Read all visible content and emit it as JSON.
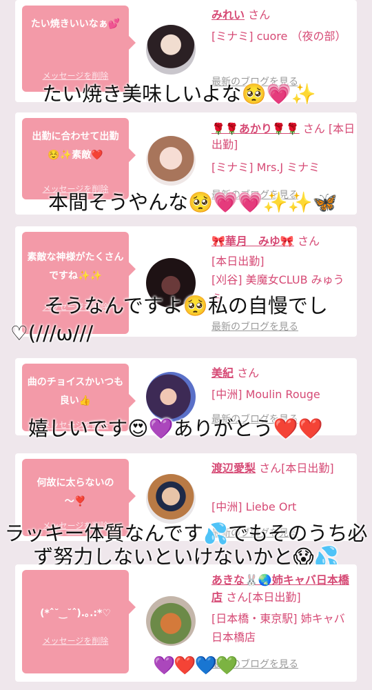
{
  "delete_label": "メッセージを削除",
  "blog_label": "最新のブログを見る",
  "san": "さん",
  "cards": [
    {
      "message": "たい焼きいいなぁ💕",
      "name": "みれい",
      "shop": "[ミナミ] cuore （夜の部）",
      "overlay": "たい焼き美味しいよな🥺💗✨"
    },
    {
      "message": "出勤に合わせて出勤☺️✨素敵❤️",
      "name": "🌹🌹あかり🌹🌹",
      "shop1": "[本日出勤]",
      "shop": "[ミナミ] Mrs.J ミナミ",
      "overlay": "本間そうやんな🥺💗💗✨✨🦋"
    },
    {
      "message": "素敵な神様がたくさんですね✨✨",
      "name": "🎀華月　みゆ🎀",
      "shop1": "[本日出勤]",
      "shop": "[刈谷] 美魔女CLUB みゅうら",
      "overlay_1": "そうなんですよ🥺私の自慢でし",
      "overlay_2": "♡(///ω///"
    },
    {
      "message": "曲のチョイスかいつも良い👍",
      "name": "美紀",
      "shop": "[中洲] Moulin Rouge",
      "overlay": "嬉しいです😍💜ありがとう❤️❤️"
    },
    {
      "message": "何故に太らないの～❣️",
      "name": "渡辺愛梨",
      "shop1": "[本日出勤]",
      "shop": "[中洲] Liebe Ort",
      "overlay_1": "ラッキー体質なんです💦でもそのうち必",
      "overlay_2": "ず努力しないといけないかと😱💦"
    },
    {
      "message": "(*ˆ˘‿˘ˆ).｡.:*♡",
      "name": "あきな🐰🌏姉キャバ日本橋店",
      "shop1": "[本日出勤]",
      "shop": "[日本橋・東京駅] 姉キャバ 日本橋店",
      "overlay": "💜❤️💙💚"
    }
  ],
  "colors": {
    "bubble": "#f39aa8",
    "name": "#d64a75",
    "background": "#efe7ec"
  }
}
